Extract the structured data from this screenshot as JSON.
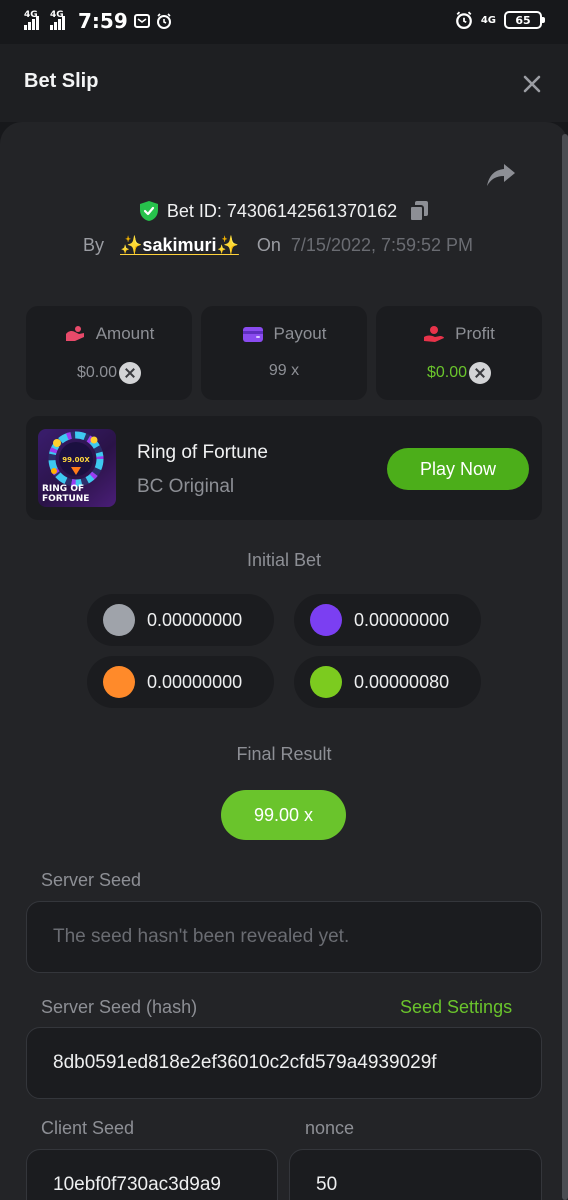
{
  "status_bar": {
    "network_left": "4G",
    "network_right": "4G",
    "time": "7:59",
    "battery": "65",
    "icons": [
      "message-icon",
      "alarm-icon"
    ]
  },
  "header": {
    "title": "Bet Slip"
  },
  "bet": {
    "bet_id": "Bet ID: 74306142561370162",
    "by_label": "By",
    "username": "✨sakimuri✨",
    "on_label": "On",
    "date": "7/15/2022, 7:59:52 PM"
  },
  "stats": {
    "amount": {
      "label": "Amount",
      "value": "$0.00"
    },
    "payout": {
      "label": "Payout",
      "value": "99 x"
    },
    "profit": {
      "label": "Profit",
      "value": "$0.00"
    }
  },
  "game": {
    "name": "Ring of Fortune",
    "subtitle": "BC Original",
    "play_label": "Play Now",
    "thumb_multiplier": "99.00X",
    "thumb_title_line1": "RING OF",
    "thumb_title_line2": "FORTUNE"
  },
  "initial_bet": {
    "title": "Initial Bet",
    "chips": [
      {
        "color": "#9fa3aa",
        "value": "0.00000000"
      },
      {
        "color": "#7b3ff2",
        "value": "0.00000000"
      },
      {
        "color": "#ff8a2a",
        "value": "0.00000000"
      },
      {
        "color": "#7ccb1f",
        "value": "0.00000080"
      }
    ]
  },
  "final_result": {
    "title": "Final Result",
    "value": "99.00 x"
  },
  "seeds": {
    "server_seed_label": "Server Seed",
    "server_seed_placeholder": "The seed hasn't been revealed yet.",
    "server_hash_label": "Server Seed (hash)",
    "seed_settings_label": "Seed Settings",
    "server_hash_value": "8db0591ed818e2ef36010c2cfd579a4939029f",
    "client_seed_label": "Client Seed",
    "client_seed_value": "10ebf0f730ac3d9a9",
    "nonce_label": "nonce",
    "nonce_value": "50"
  },
  "colors": {
    "accent_green": "#6ac42c",
    "play_button": "#4cae1a",
    "background": "#17181b",
    "card": "#232427"
  }
}
